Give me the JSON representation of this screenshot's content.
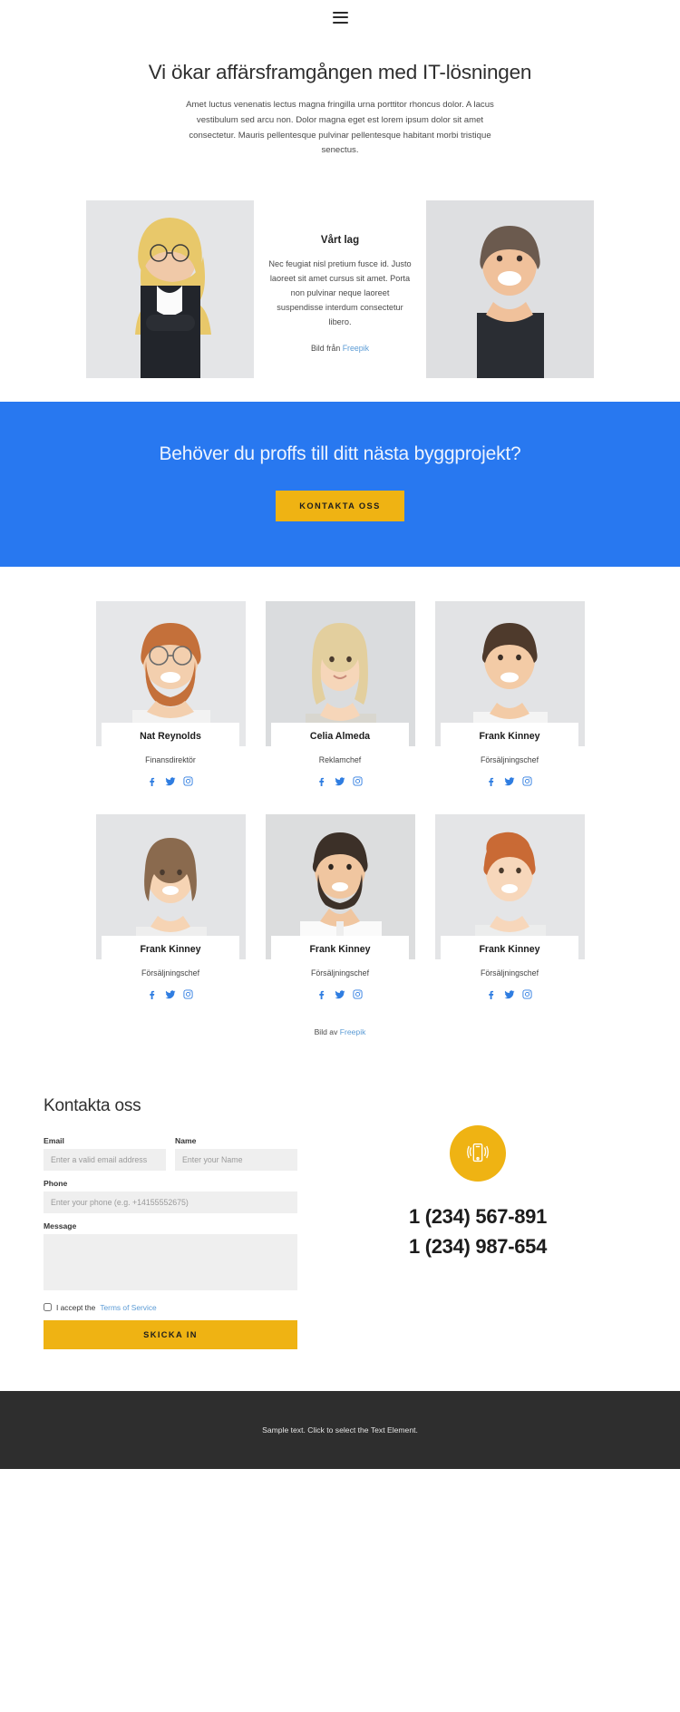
{
  "header": {
    "menu_icon": "hamburger-menu-icon"
  },
  "hero": {
    "title": "Vi ökar affärsframgången med IT-lösningen",
    "subtitle": "Amet luctus venenatis lectus magna fringilla urna porttitor rhoncus dolor. A lacus vestibulum sed arcu non. Dolor magna eget est lorem ipsum dolor sit amet consectetur. Mauris pellentesque pulvinar pellentesque habitant morbi tristique senectus."
  },
  "team_intro": {
    "heading": "Vårt lag",
    "body": "Nec feugiat nisl pretium fusce id. Justo laoreet sit amet cursus sit amet. Porta non pulvinar neque laoreet suspendisse interdum consectetur libero.",
    "credit_prefix": "Bild från ",
    "credit_link": "Freepik",
    "left_photo_alt": "woman-in-black-blazer-photo",
    "right_photo_alt": "man-in-black-tshirt-photo"
  },
  "cta": {
    "heading": "Behöver du proffs till ditt nästa byggprojekt?",
    "button_label": "KONTAKTA OSS",
    "background_color": "#2878f0",
    "button_color": "#efb313"
  },
  "team": {
    "social_icons": [
      "facebook-icon",
      "twitter-icon",
      "instagram-icon"
    ],
    "members": [
      {
        "name": "Nat Reynolds",
        "role": "Finansdirektör",
        "photo": "bearded-man-with-glasses-photo"
      },
      {
        "name": "Celia Almeda",
        "role": "Reklamchef",
        "photo": "blonde-woman-photo"
      },
      {
        "name": "Frank Kinney",
        "role": "Försäljningschef",
        "photo": "young-smiling-man-photo"
      },
      {
        "name": "Frank Kinney",
        "role": "Försäljningschef",
        "photo": "woman-short-hair-photo"
      },
      {
        "name": "Frank Kinney",
        "role": "Försäljningschef",
        "photo": "bearded-man-white-shirt-photo"
      },
      {
        "name": "Frank Kinney",
        "role": "Försäljningschef",
        "photo": "redhead-woman-photo"
      }
    ],
    "credit_prefix": "Bild av ",
    "credit_link": "Freepik"
  },
  "contact": {
    "heading": "Kontakta oss",
    "fields": {
      "email": {
        "label": "Email",
        "placeholder": "Enter a valid email address",
        "value": ""
      },
      "name": {
        "label": "Name",
        "placeholder": "Enter your Name",
        "value": ""
      },
      "phone": {
        "label": "Phone",
        "placeholder": "Enter your phone (e.g. +14155552675)",
        "value": ""
      },
      "message": {
        "label": "Message",
        "placeholder": "",
        "value": ""
      }
    },
    "accept_prefix": "I accept the ",
    "accept_link": "Terms of Service",
    "submit_label": "SKICKA IN",
    "phone_icon": "mobile-phone-ringing-icon",
    "phone_numbers": [
      "1 (234) 567-891",
      "1 (234) 987-654"
    ]
  },
  "footer": {
    "text": "Sample text. Click to select the Text Element."
  }
}
